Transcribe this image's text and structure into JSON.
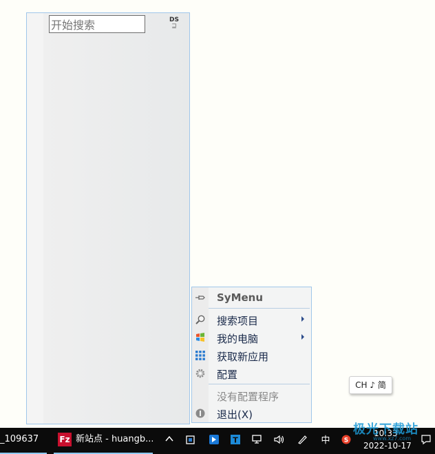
{
  "launcher": {
    "search_placeholder": "开始搜索",
    "ds_icon_text": "DS",
    "ds_icon_sub": "⊒"
  },
  "menu": {
    "title": "SyMenu",
    "items": [
      {
        "label": "搜索项目",
        "icon": "magnifier-icon",
        "submenu": true
      },
      {
        "label": "我的电脑",
        "icon": "windows-icon",
        "submenu": true
      },
      {
        "label": "获取新应用",
        "icon": "grid-icon",
        "submenu": false
      },
      {
        "label": "配置",
        "icon": "gear-icon",
        "submenu": false
      }
    ],
    "disabled_item": "没有配置程序",
    "exit_label": "退出(X)"
  },
  "ime_tooltip": "CH ♪ 简",
  "taskbar": {
    "task1_label": "_109637",
    "task2_label": "新站点 - huangb...",
    "time": "10:33",
    "date": "2022-10-17",
    "ime_char": "中"
  },
  "watermark": {
    "text": "极光下载站",
    "sub": "www.xz7.com"
  },
  "colors": {
    "panel_border": "#9fc6ea",
    "taskbar": "#0b0b0b",
    "accent": "#8cc8f0"
  }
}
